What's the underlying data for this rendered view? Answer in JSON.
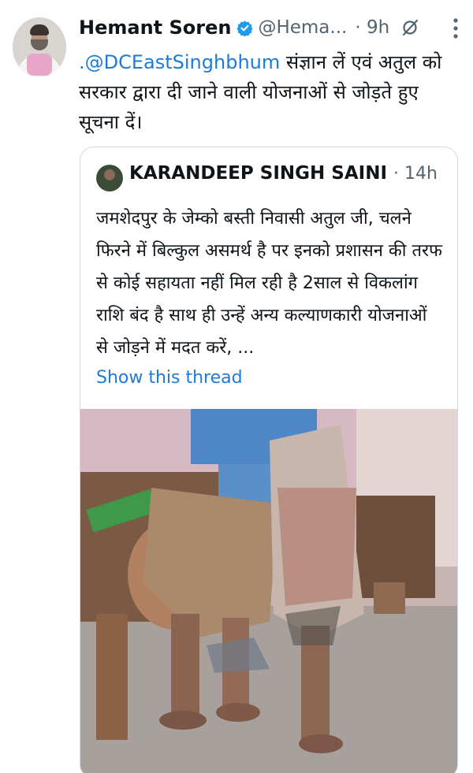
{
  "tweet": {
    "author_name": "Hemant Soren",
    "handle": "@Hema...",
    "time": "· 9h",
    "mention": ".@DCEastSinghbhum",
    "text": " संज्ञान लें एवं अतुल को सरकार द्वारा दी जाने वाली योजनाओं से जोड़ते हुए सूचना दें।",
    "icons": {
      "verified": "verified-badge-icon",
      "grok": "grok-icon",
      "more": "more-vertical-icon"
    },
    "colors": {
      "link": "#1d7bd7",
      "verified": "#1d9bf0",
      "secondary_text": "#536471"
    }
  },
  "quoted_tweet": {
    "author_name": "KARANDEEP SINGH SAINI",
    "time": "· 14h",
    "text": "जमशेदपुर के जेम्को बस्ती निवासी अतुल जी, चलने फिरने में बिल्कुल असमर्थ है पर इनको प्रशासन की तरफ से कोई सहायता नहीं मिल रही है 2साल से विकलांग राशि बंद है साथ ही उन्हें अन्य कल्याणकारी योजनाओं से जोड़ने में मदत करें, ...",
    "show_thread_label": "Show this thread"
  }
}
